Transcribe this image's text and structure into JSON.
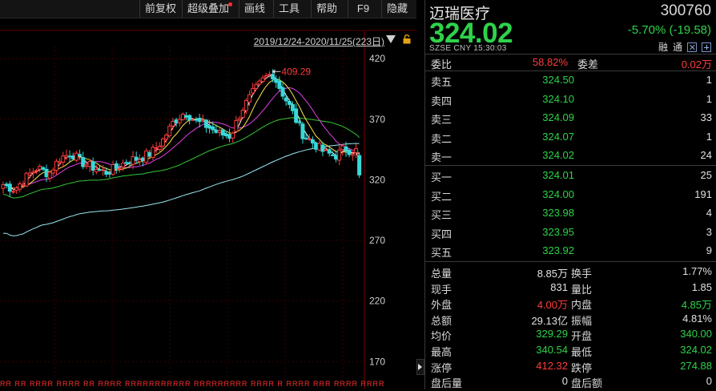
{
  "toolbar": {
    "items": [
      "前复权",
      "超级叠加",
      "画线",
      "工具",
      "帮助",
      "F9",
      "隐藏"
    ]
  },
  "range": {
    "text": "2019/12/24-2020/11/25(223日)"
  },
  "chart_data": {
    "type": "candlestick",
    "y_ticks": [
      420,
      370,
      320,
      270,
      220,
      170
    ],
    "ylim": [
      155,
      430
    ],
    "peak_label": "409.29",
    "peak_value": 409.29,
    "colors": {
      "up": "#ff3b3b",
      "down": "#38d8d8",
      "ma5": "#ffffff",
      "ma10": "#f6e64a",
      "ma20": "#e13ee6",
      "ma60": "#33c833",
      "ma120": "#9be8f0",
      "grid": "#3a0000"
    },
    "bottom_marks": "RR RR  RRRR  RRRR RR RRRR RRRRRRRRRRR RRRRRRRRR RRRR R RRRR RRR RRRR RRRR"
  },
  "quote": {
    "name": "迈瑞医疗",
    "code": "300760",
    "price": "324.02",
    "change": "-5.70% (-19.58)",
    "exchange": "SZSE  CNY  15:30:03",
    "badges": [
      "融",
      "通"
    ],
    "weibi_label": "委比",
    "weibi_value": "58.82%",
    "weicha_label": "委差",
    "weicha_value": "0.02万",
    "asks": [
      {
        "label": "卖五",
        "price": "324.50",
        "vol": "1"
      },
      {
        "label": "卖四",
        "price": "324.10",
        "vol": "1"
      },
      {
        "label": "卖三",
        "price": "324.09",
        "vol": "33"
      },
      {
        "label": "卖二",
        "price": "324.07",
        "vol": "1"
      },
      {
        "label": "卖一",
        "price": "324.02",
        "vol": "24"
      }
    ],
    "bids": [
      {
        "label": "买一",
        "price": "324.01",
        "vol": "25"
      },
      {
        "label": "买二",
        "price": "324.00",
        "vol": "191"
      },
      {
        "label": "买三",
        "price": "323.98",
        "vol": "4"
      },
      {
        "label": "买四",
        "price": "323.95",
        "vol": "3"
      },
      {
        "label": "买五",
        "price": "323.92",
        "vol": "9"
      }
    ],
    "stats": [
      {
        "l1": "总量",
        "v1": "8.85万",
        "c1": "wh",
        "l2": "换手",
        "v2": "1.77%",
        "c2": "wh"
      },
      {
        "l1": "现手",
        "v1": "831",
        "c1": "wh",
        "l2": "量比",
        "v2": "1.85",
        "c2": "wh"
      },
      {
        "l1": "外盘",
        "v1": "4.00万",
        "c1": "up",
        "l2": "内盘",
        "v2": "4.85万",
        "c2": "dn"
      },
      {
        "l1": "总额",
        "v1": "29.13亿",
        "c1": "wh",
        "l2": "振幅",
        "v2": "4.81%",
        "c2": "wh"
      },
      {
        "l1": "均价",
        "v1": "329.29",
        "c1": "dn",
        "l2": "开盘",
        "v2": "340.00",
        "c2": "dn"
      },
      {
        "l1": "最高",
        "v1": "340.54",
        "c1": "dn",
        "l2": "最低",
        "v2": "324.02",
        "c2": "dn"
      },
      {
        "l1": "涨停",
        "v1": "412.32",
        "c1": "up",
        "l2": "跌停",
        "v2": "274.88",
        "c2": "dn"
      },
      {
        "l1": "盘后量",
        "v1": "0",
        "c1": "wh",
        "l2": "盘后额",
        "v2": "0",
        "c2": "wh"
      }
    ]
  }
}
